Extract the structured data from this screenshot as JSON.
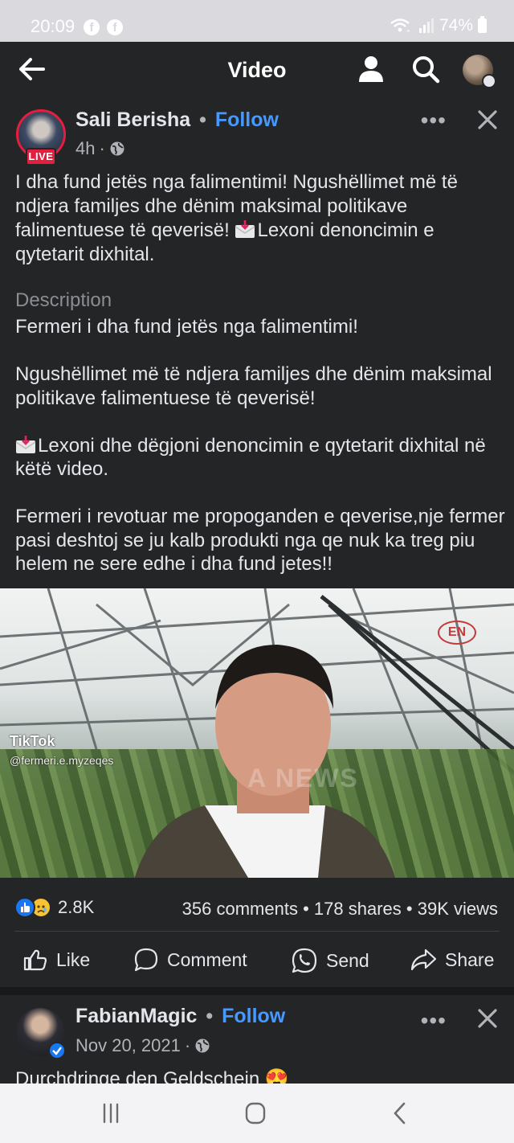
{
  "status_bar": {
    "time": "20:09",
    "fb_notification_icons": [
      "facebook-icon",
      "facebook-icon"
    ],
    "battery": "74%",
    "icons": [
      "wifi-icon",
      "signal-icon",
      "battery-icon"
    ]
  },
  "app_bar": {
    "title": "Video",
    "icons": [
      "back-arrow-icon",
      "profile-icon",
      "search-icon",
      "account-avatar"
    ]
  },
  "post": {
    "author": "Sali Berisha",
    "separator": "•",
    "follow_label": "Follow",
    "live_badge": "LIVE",
    "time": "4h",
    "audience_icon": "globe-icon",
    "caption_part1": "I dha fund jetës nga falimentimi!   Ngushëllimet më të ndjera familjes dhe dënim maksimal politikave falimentuese të qeverisë!  ",
    "caption_part2": "Lexoni denoncimin e qytetarit dixhital.",
    "description_label": "Description",
    "description": {
      "p1": "Fermeri i dha fund jetës nga falimentimi!",
      "p2": "Ngushëllimet më të ndjera familjes dhe dënim maksimal politikave falimentuese të qeverisë!",
      "p3": "Lexoni dhe dëgjoni denoncimin e qytetarit dixhital në këtë video.",
      "p4": "Fermeri i revotuar me propoganden e qeverise,nje fermer pasi deshtoj se ju kalb produkti nga qe nuk ka treg piu helem ne sere edhe i dha fund jetes!!"
    },
    "video": {
      "tiktok_label": "TikTok",
      "tiktok_handle": "@fermeri.e.myzeqes",
      "logo_text": "EN",
      "watermark": "A NEWS"
    },
    "reactions_count": "2.8K",
    "comments": "356 comments",
    "shares": "178 shares",
    "views": "39K views",
    "dot": "•",
    "actions": {
      "like": "Like",
      "comment": "Comment",
      "send": "Send",
      "share": "Share"
    }
  },
  "post2": {
    "author": "FabianMagic",
    "separator": "•",
    "follow_label": "Follow",
    "date": "Nov 20, 2021",
    "dot": "·",
    "text": "Durchdringe den Geldschein 😍"
  },
  "meta_dot": "·",
  "colors": {
    "background": "#242526",
    "accent": "#4599ff",
    "live": "#e41e3f",
    "status_bar": "#d9d9de",
    "nav_bar": "#f3f3f5"
  }
}
